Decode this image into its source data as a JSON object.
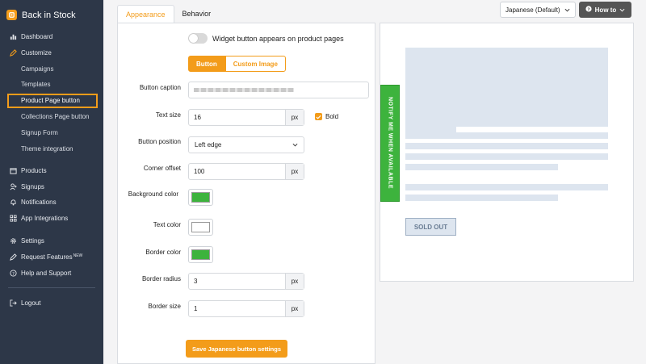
{
  "app": {
    "name": "Back in Stock",
    "logo_icon": "bell-icon",
    "accent": "#f39c1a"
  },
  "sidebar": {
    "dashboard": "Dashboard",
    "customize": "Customize",
    "sub": [
      "Campaigns",
      "Templates",
      "Product Page button",
      "Collections Page button",
      "Signup Form",
      "Theme integration"
    ],
    "products": "Products",
    "signups": "Signups",
    "notifications": "Notifications",
    "app_integrations": "App Integrations",
    "settings": "Settings",
    "request_features": "Request Features",
    "new_badge": "NEW",
    "help": "Help and Support",
    "logout": "Logout"
  },
  "tabs": {
    "appearance": "Appearance",
    "behavior": "Behavior"
  },
  "topbar": {
    "language": "Japanese (Default)",
    "how_to": "How to"
  },
  "form": {
    "widget_toggle_label": "Widget button appears on product pages",
    "seg_button": "Button",
    "seg_custom_image": "Custom Image",
    "button_caption_label": "Button caption",
    "text_size_label": "Text size",
    "text_size_value": "16",
    "unit_px": "px",
    "bold_label": "Bold",
    "button_position_label": "Button position",
    "button_position_value": "Left edge",
    "corner_offset_label": "Corner offset",
    "corner_offset_value": "100",
    "background_color_label": "Background color",
    "background_color": "#3db33d",
    "text_color_label": "Text color",
    "text_color": "#ffffff",
    "border_color_label": "Border color",
    "border_color": "#3db33d",
    "border_radius_label": "Border radius",
    "border_radius_value": "3",
    "border_size_label": "Border size",
    "border_size_value": "1",
    "save_label": "Save Japanese button settings"
  },
  "preview": {
    "notify_label": "NOTIFY ME WHEN AVAILABLE",
    "sold_out": "SOLD OUT"
  }
}
